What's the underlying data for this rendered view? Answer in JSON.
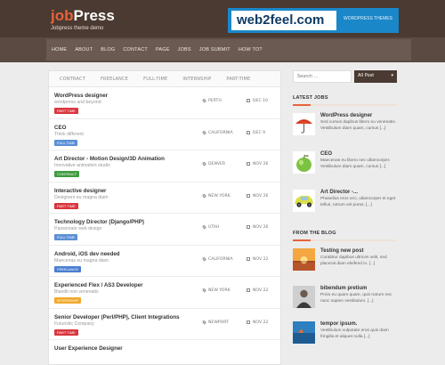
{
  "header": {
    "logo_part1": "job",
    "logo_part2": "Press",
    "tagline": "Jobpress theme demo",
    "banner_logo": "web2feel.com",
    "banner_text": "WORDPRESS THEMES"
  },
  "nav": [
    "HOME",
    "ABOUT",
    "BLOG",
    "CONTACT",
    "PAGE",
    "JOBS",
    "JOB SUBMIT",
    "HOW TO?"
  ],
  "filters": [
    "CONTRACT",
    "FREELANCE",
    "FULL-TIME",
    "INTERNSHIP",
    "PART-TIME"
  ],
  "jobs": [
    {
      "title": "WordPress designer",
      "subtitle": "wordpress and beyond",
      "type": "PART TIME",
      "color": "#d9363e",
      "location": "PERTH",
      "date": "DEC 10"
    },
    {
      "title": "CEO",
      "subtitle": "Think different",
      "type": "FULL TIME",
      "color": "#5b8fd6",
      "location": "CALIFORNIA",
      "date": "DEC 9"
    },
    {
      "title": "Art Director - Motion Design/3D Animation",
      "subtitle": "Innovative animation studio",
      "type": "CONTRACT",
      "color": "#3f9b3f",
      "location": "DENVER",
      "date": "NOV 26"
    },
    {
      "title": "Interactive designer",
      "subtitle": "Designers eu magna diam",
      "type": "PART TIME",
      "color": "#d9363e",
      "location": "NEW YORK",
      "date": "NOV 26"
    },
    {
      "title": "Technology Director (Django/PHP)",
      "subtitle": "Passionate web design",
      "type": "FULL TIME",
      "color": "#5b8fd6",
      "location": "UTAH",
      "date": "NOV 26"
    },
    {
      "title": "Android, iOS dev needed",
      "subtitle": "Maecenas eu magna diam",
      "type": "FREELANCE",
      "color": "#4a7fd0",
      "location": "CALIFORNIA",
      "date": "NOV 22"
    },
    {
      "title": "Experienced Flex / AS3 Developer",
      "subtitle": "Blandit non venenatis",
      "type": "INTERNSHIP",
      "color": "#f0a92c",
      "location": "NEW YORK",
      "date": "NOV 22"
    },
    {
      "title": "Senior Developer (Perl/PHP), Client Integrations",
      "subtitle": "Futuristic Company",
      "type": "PART TIME",
      "color": "#d9363e",
      "location": "NEWPORT",
      "date": "NOV 22"
    },
    {
      "title": "User Experience Designer",
      "subtitle": "",
      "type": "",
      "color": "#d9363e",
      "location": "",
      "date": ""
    }
  ],
  "sidebar": {
    "search_placeholder": "Search ...",
    "search_select": "All Post",
    "latest_jobs_title": "LATEST JOBS",
    "latest_jobs": [
      {
        "title": "WordPress designer",
        "body": "Sed cursus dapibus libero eu venenatis. Vestibulum diam quam, cursus [...]"
      },
      {
        "title": "CEO",
        "body": "Maecenas eu libero nec ullamcorper. Vestibulum diam quam, cursus [...]"
      },
      {
        "title": "Art Director -...",
        "body": "Phasellus eros orci, ullamcorper et eget tellus, rutrum vel purus. [...]"
      }
    ],
    "blog_title": "FROM THE BLOG",
    "blog": [
      {
        "title": "Testing new post",
        "body": "Curabitur dapibus ultrices velit, sed placerat diam eleifend in. [...]"
      },
      {
        "title": "bibendum pretium",
        "body": "Proin eu quam quam, quis rutrum nec nunc sapien vestibulum. [...]"
      },
      {
        "title": "tempor ipsum.",
        "body": "Vestibulum vulputate eros quis diam fringilla et aliquet nulla [...]"
      }
    ]
  }
}
